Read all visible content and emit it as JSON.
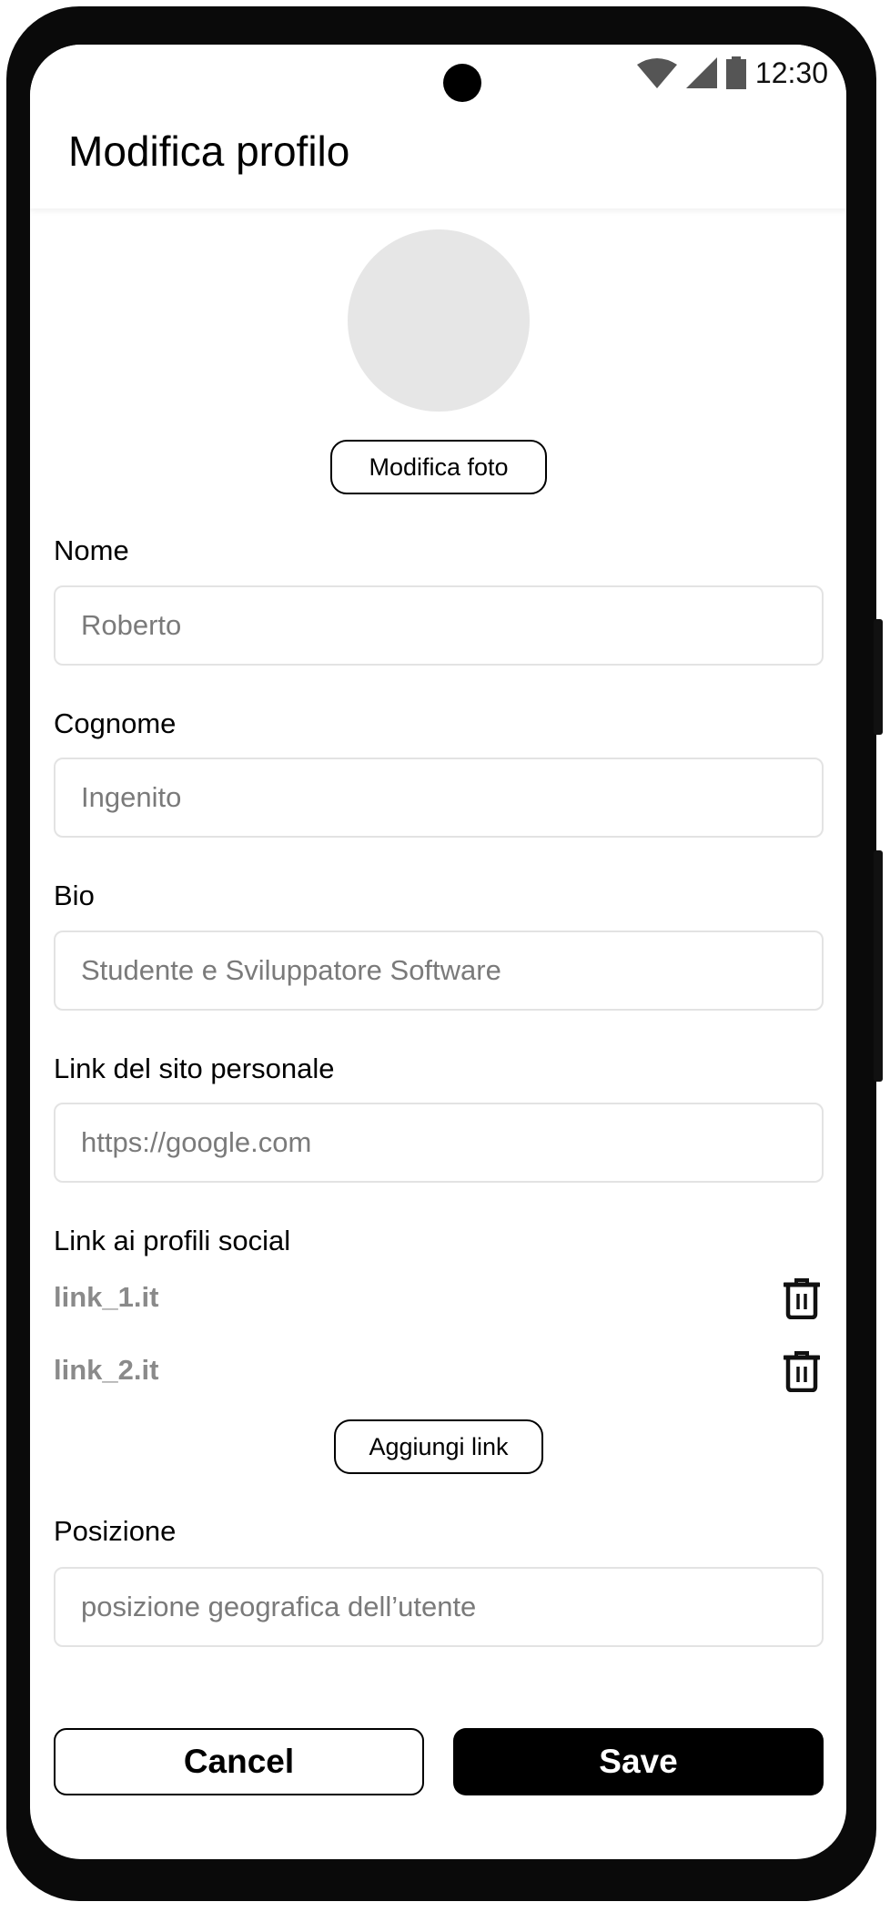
{
  "status_bar": {
    "time": "12:30",
    "icons": [
      "wifi-icon",
      "signal-icon",
      "battery-icon"
    ]
  },
  "header": {
    "title": "Modifica profilo"
  },
  "avatar": {
    "button_label": "Modifica foto"
  },
  "fields": [
    {
      "label": "Nome",
      "placeholder": "Roberto"
    },
    {
      "label": "Cognome",
      "placeholder": "Ingenito"
    },
    {
      "label": "Bio",
      "placeholder": "Studente e Sviluppatore Software"
    },
    {
      "label": "Link del sito personale",
      "placeholder": "https://google.com"
    }
  ],
  "social": {
    "label": "Link ai profili social",
    "links": [
      "link_1.it",
      "link_2.it"
    ],
    "delete_icon": "trash-icon",
    "add_label": "Aggiungi link"
  },
  "position": {
    "label": "Posizione",
    "placeholder": "posizione geografica dell’utente"
  },
  "actions": {
    "cancel": "Cancel",
    "save": "Save"
  }
}
